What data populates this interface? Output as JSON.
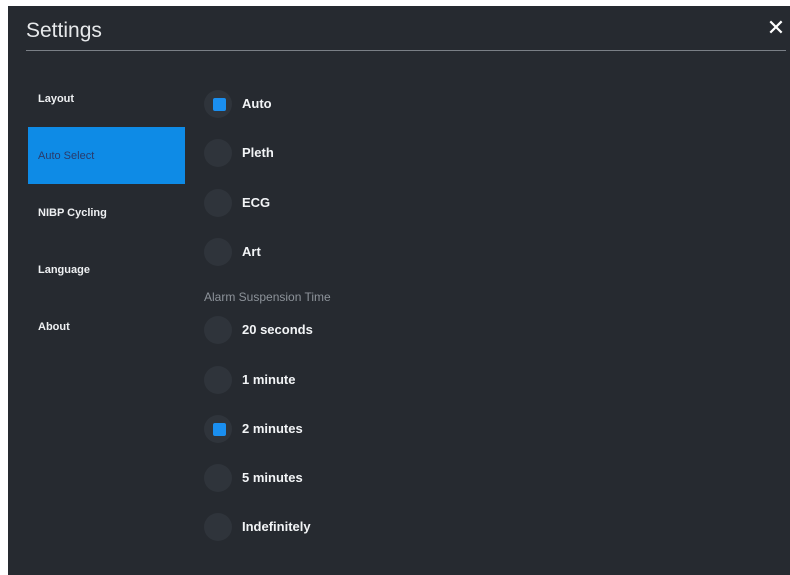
{
  "window": {
    "title": "Settings",
    "close_icon": "close-icon"
  },
  "sidebar": {
    "items": [
      {
        "label": "Layout",
        "active": false
      },
      {
        "label": "Auto Select",
        "active": true
      },
      {
        "label": "NIBP Cycling",
        "active": false
      },
      {
        "label": "Language",
        "active": false
      },
      {
        "label": "About",
        "active": false
      }
    ]
  },
  "auto_select": {
    "options": [
      {
        "label": "Auto",
        "selected": true
      },
      {
        "label": "Pleth",
        "selected": false
      },
      {
        "label": "ECG",
        "selected": false
      },
      {
        "label": "Art",
        "selected": false
      }
    ]
  },
  "alarm_suspension": {
    "label": "Alarm Suspension Time",
    "options": [
      {
        "label": "20 seconds",
        "selected": false
      },
      {
        "label": "1 minute",
        "selected": false
      },
      {
        "label": "2 minutes",
        "selected": true
      },
      {
        "label": "5 minutes",
        "selected": false
      },
      {
        "label": "Indefinitely",
        "selected": false
      }
    ]
  },
  "colors": {
    "background": "#262a30",
    "accent": "#1a8ff0",
    "active_nav": "#0e8be6",
    "text": "#f2f4f6",
    "muted_text": "#8d939a"
  }
}
